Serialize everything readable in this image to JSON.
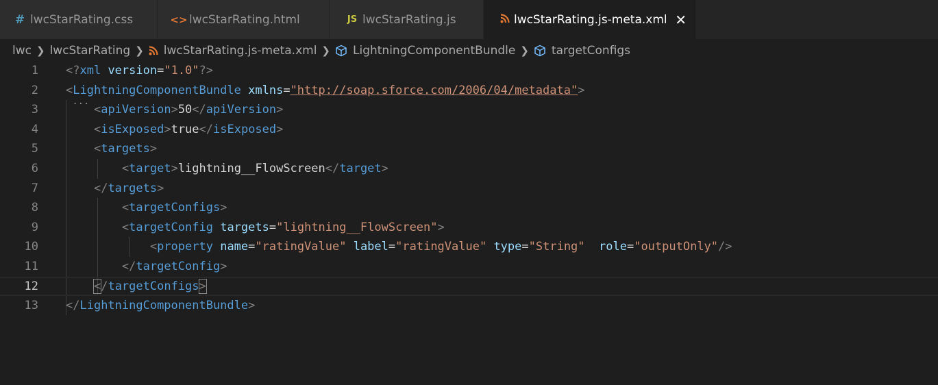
{
  "tabs": [
    {
      "icon": "#",
      "icon_color": "#519aba",
      "label": "lwcStarRating.css",
      "active": false
    },
    {
      "icon": "<>",
      "icon_color": "#e37933",
      "label": "lwcStarRating.html",
      "active": false
    },
    {
      "icon": "JS",
      "icon_color": "#cbcb41",
      "label": "lwcStarRating.js",
      "active": false
    },
    {
      "icon": "rss",
      "icon_color": "#e37933",
      "label": "lwcStarRating.js-meta.xml",
      "active": true
    }
  ],
  "breadcrumb": {
    "items": [
      "lwc",
      "lwcStarRating",
      "lwcStarRating.js-meta.xml",
      "LightningComponentBundle",
      "targetConfigs"
    ]
  },
  "editor": {
    "current_line": 12,
    "line_numbers": [
      "1",
      "2",
      "3",
      "4",
      "5",
      "6",
      "7",
      "8",
      "9",
      "10",
      "11",
      "12",
      "13"
    ],
    "lines": [
      [
        [
          "punct",
          "<?"
        ],
        [
          "tag",
          "xml "
        ],
        [
          "attr",
          "version"
        ],
        [
          "text",
          "="
        ],
        [
          "str",
          "\"1.0\""
        ],
        [
          "punct",
          "?>"
        ]
      ],
      [
        [
          "punct",
          "<"
        ],
        [
          "tag",
          "LightningComponentBundle "
        ],
        [
          "attr",
          "xmlns"
        ],
        [
          "text",
          "="
        ],
        [
          "url",
          "\"http://soap.sforce.com/2006/04/metadata\""
        ],
        [
          "punct",
          ">"
        ]
      ],
      [
        [
          "text",
          "    "
        ],
        [
          "punct",
          "<"
        ],
        [
          "tag",
          "apiVersion"
        ],
        [
          "punct",
          ">"
        ],
        [
          "text",
          "50"
        ],
        [
          "punct",
          "</"
        ],
        [
          "tag",
          "apiVersion"
        ],
        [
          "punct",
          ">"
        ]
      ],
      [
        [
          "text",
          "    "
        ],
        [
          "punct",
          "<"
        ],
        [
          "tag",
          "isExposed"
        ],
        [
          "punct",
          ">"
        ],
        [
          "text",
          "true"
        ],
        [
          "punct",
          "</"
        ],
        [
          "tag",
          "isExposed"
        ],
        [
          "punct",
          ">"
        ]
      ],
      [
        [
          "text",
          "    "
        ],
        [
          "punct",
          "<"
        ],
        [
          "tag",
          "targets"
        ],
        [
          "punct",
          ">"
        ]
      ],
      [
        [
          "text",
          "        "
        ],
        [
          "punct",
          "<"
        ],
        [
          "tag",
          "target"
        ],
        [
          "punct",
          ">"
        ],
        [
          "text",
          "lightning__FlowScreen"
        ],
        [
          "punct",
          "</"
        ],
        [
          "tag",
          "target"
        ],
        [
          "punct",
          ">"
        ]
      ],
      [
        [
          "text",
          "    "
        ],
        [
          "punct",
          "</"
        ],
        [
          "tag",
          "targets"
        ],
        [
          "punct",
          ">"
        ]
      ],
      [
        [
          "text",
          "        "
        ],
        [
          "punct",
          "<"
        ],
        [
          "tag",
          "targetConfigs"
        ],
        [
          "punct",
          ">"
        ]
      ],
      [
        [
          "text",
          "        "
        ],
        [
          "punct",
          "<"
        ],
        [
          "tag",
          "targetConfig "
        ],
        [
          "attr",
          "targets"
        ],
        [
          "text",
          "="
        ],
        [
          "str",
          "\"lightning__FlowScreen\""
        ],
        [
          "punct",
          ">"
        ]
      ],
      [
        [
          "text",
          "            "
        ],
        [
          "punct",
          "<"
        ],
        [
          "tag",
          "property "
        ],
        [
          "attr",
          "name"
        ],
        [
          "text",
          "="
        ],
        [
          "str",
          "\"ratingValue\" "
        ],
        [
          "attr",
          "label"
        ],
        [
          "text",
          "="
        ],
        [
          "str",
          "\"ratingValue\" "
        ],
        [
          "attr",
          "type"
        ],
        [
          "text",
          "="
        ],
        [
          "str",
          "\"String\"  "
        ],
        [
          "attr",
          "role"
        ],
        [
          "text",
          "="
        ],
        [
          "str",
          "\"outputOnly\""
        ],
        [
          "punct",
          "/>"
        ]
      ],
      [
        [
          "text",
          "        "
        ],
        [
          "punct",
          "</"
        ],
        [
          "tag",
          "targetConfig"
        ],
        [
          "punct",
          ">"
        ]
      ],
      [
        [
          "text",
          "    "
        ],
        [
          "bpunct",
          "<"
        ],
        [
          "punct",
          "/"
        ],
        [
          "tag",
          "targetConfigs"
        ],
        [
          "bpunct",
          ">"
        ]
      ],
      [
        [
          "punct",
          "</"
        ],
        [
          "tag",
          "LightningComponentBundle"
        ],
        [
          "punct",
          ">"
        ]
      ]
    ]
  },
  "colors": {
    "background": "#1e1e1e",
    "tab_inactive": "#2d2d2d",
    "tag": "#569cd6",
    "attribute": "#9cdcfe",
    "string": "#ce9178"
  }
}
